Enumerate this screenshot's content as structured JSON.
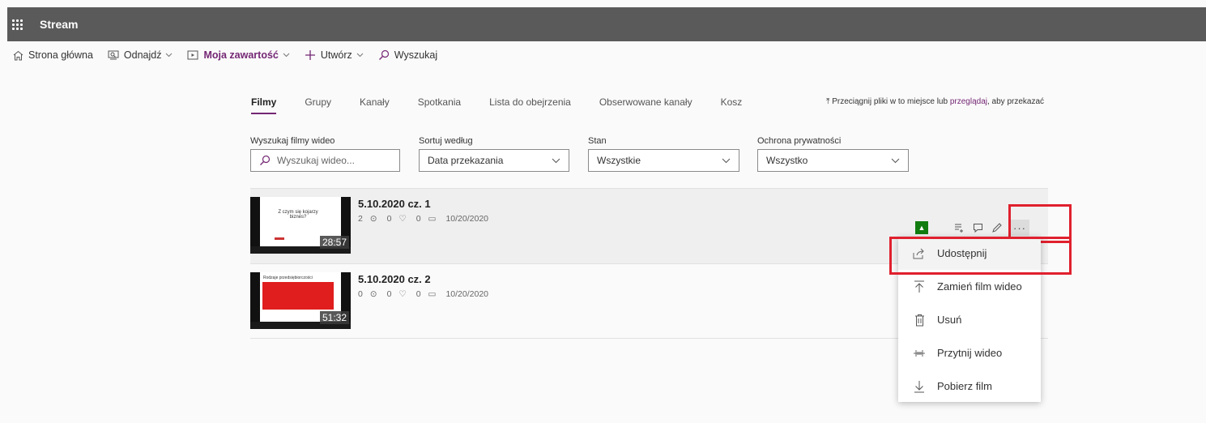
{
  "app": {
    "name": "Stream"
  },
  "nav": {
    "home": "Strona główna",
    "discover": "Odnajdź",
    "my_content": "Moja zawartość",
    "create": "Utwórz",
    "search": "Wyszukaj"
  },
  "tabs": [
    "Filmy",
    "Grupy",
    "Kanały",
    "Spotkania",
    "Lista do obejrzenia",
    "Obserwowane kanały",
    "Kosz"
  ],
  "upload_hint": {
    "before": "Przeciągnij pliki w to miejsce lub ",
    "link": "przeglądaj",
    "after": ", aby przekazać"
  },
  "filters": {
    "search": {
      "label": "Wyszukaj filmy wideo",
      "placeholder": "Wyszukaj wideo..."
    },
    "sort": {
      "label": "Sortuj według",
      "value": "Data przekazania"
    },
    "status": {
      "label": "Stan",
      "value": "Wszystkie"
    },
    "privacy": {
      "label": "Ochrona prywatności",
      "value": "Wszystko"
    }
  },
  "videos": [
    {
      "title": "5.10.2020 cz. 1",
      "views": "2",
      "likes": "0",
      "comments": "0",
      "date": "10/20/2020",
      "duration": "28:57",
      "thumb_text": "Z czym się kojarzy biznes?"
    },
    {
      "title": "5.10.2020 cz. 2",
      "views": "0",
      "likes": "0",
      "comments": "0",
      "date": "10/20/2020",
      "duration": "51:32",
      "thumb_text": "Rodzaje przedsiębiorczości"
    }
  ],
  "more_label": "···",
  "context_menu": [
    {
      "label": "Udostępnij",
      "icon": "share-icon"
    },
    {
      "label": "Zamień film wideo",
      "icon": "upload-icon"
    },
    {
      "label": "Usuń",
      "icon": "trash-icon"
    },
    {
      "label": "Przytnij wideo",
      "icon": "trim-icon"
    },
    {
      "label": "Pobierz film",
      "icon": "download-icon"
    }
  ],
  "colors": {
    "accent": "#742774",
    "topbar": "#5a5a5a",
    "highlight": "#e0202e",
    "status_green": "#107c10"
  }
}
